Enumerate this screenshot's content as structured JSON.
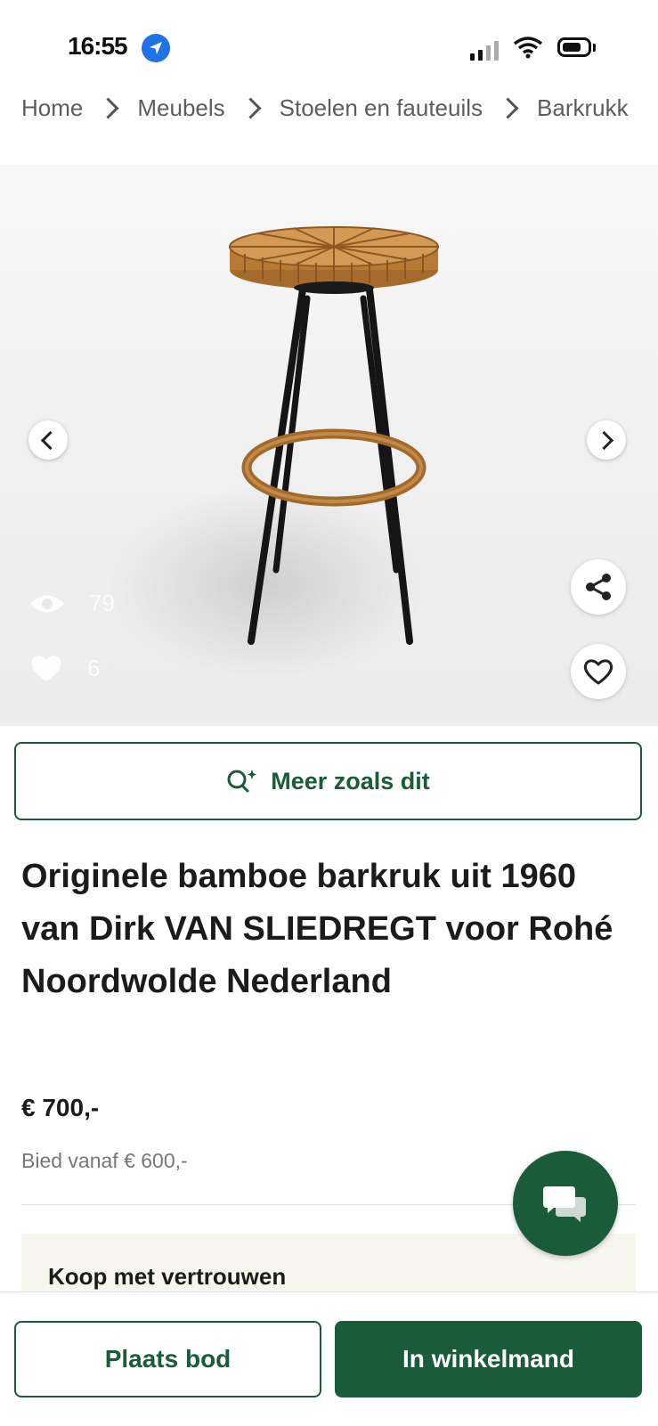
{
  "status_bar": {
    "time": "16:55"
  },
  "breadcrumb": [
    "Home",
    "Meubels",
    "Stoelen en fauteuils",
    "Barkrukk"
  ],
  "gallery": {
    "views": "79",
    "likes": "6"
  },
  "more_like_this": {
    "label": "Meer zoals dit"
  },
  "product": {
    "title": "Originele bamboe barkruk uit 1960 van Dirk VAN SLIEDREGT voor Rohé Noordwolde Nederland",
    "price": "€ 700,-",
    "bid_from": "Bied vanaf € 600,-"
  },
  "trust": {
    "label": "Koop met vertrouwen"
  },
  "actions": {
    "bid": "Plaats bod",
    "cart": "In winkelmand"
  },
  "colors": {
    "brand": "#1a5c3a",
    "link_blue": "#1e73e8",
    "trust_bg": "#f7f6ee"
  },
  "icons": [
    "location-arrow-icon",
    "signal-icon",
    "wifi-icon",
    "battery-icon",
    "chevron-left-icon",
    "chevron-right-icon",
    "share-icon",
    "heart-icon",
    "eye-icon",
    "search-sparkle-icon",
    "chat-icon"
  ]
}
